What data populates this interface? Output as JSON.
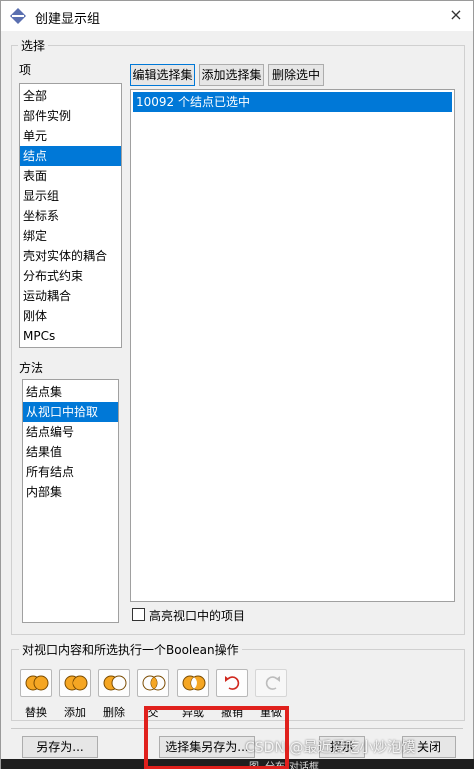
{
  "window": {
    "title": "创建显示组",
    "close_icon": "×"
  },
  "selection_group": {
    "label": "选择"
  },
  "item_panel": {
    "label": "项",
    "items": [
      "全部",
      "部件实例",
      "单元",
      "结点",
      "表面",
      "显示组",
      "坐标系",
      "绑定",
      "壳对实体的耦合",
      "分布式约束",
      "运动耦合",
      "刚体",
      "MPCs"
    ],
    "selected_index": 3
  },
  "method_panel": {
    "label": "方法",
    "items": [
      "结点集",
      "从视口中拾取",
      "结点编号",
      "结果值",
      "所有结点",
      "内部集"
    ],
    "selected_index": 1
  },
  "toolbar": {
    "edit_selection": "编辑选择集",
    "add_selection": "添加选择集",
    "delete_selection": "删除选中"
  },
  "result_list": {
    "items": [
      "10092 个结点已选中"
    ],
    "selected_index": 0
  },
  "highlight_checkbox": {
    "label": "高亮视口中的项目",
    "checked": false
  },
  "boolean_group": {
    "label": "对视口内容和所选执行一个Boolean操作",
    "buttons": [
      {
        "icon": "replace-icon",
        "label": "替换"
      },
      {
        "icon": "add-icon",
        "label": "添加"
      },
      {
        "icon": "remove-icon",
        "label": "删除"
      },
      {
        "icon": "intersect-icon",
        "label": "交"
      },
      {
        "icon": "xor-icon",
        "label": "异或"
      },
      {
        "icon": "undo-icon",
        "label": "撤销"
      },
      {
        "icon": "redo-icon",
        "label": "重做"
      }
    ]
  },
  "bottom_buttons": {
    "save_as": "另存为...",
    "save_selection_as": "选择集另存为...",
    "hint": "提示",
    "close": "关闭"
  },
  "overlay": {
    "watermark": "CSDN @最近爱吃小炒泡馍",
    "strip_text_1": "图",
    "strip_text_2": "分布",
    "strip_text_3": "对话框"
  },
  "colors": {
    "selection": "#0078d7",
    "highlight_box": "#e0201c",
    "venn_fill": "#f5a623"
  }
}
